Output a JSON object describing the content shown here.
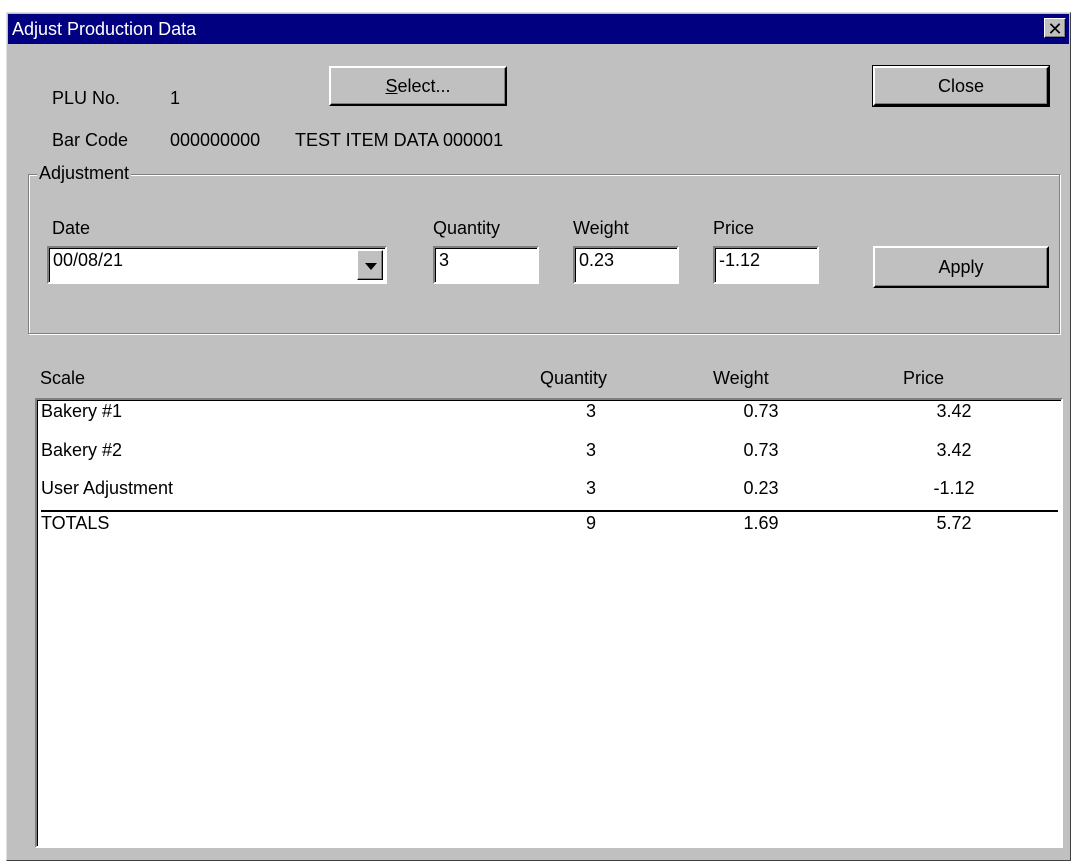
{
  "window": {
    "title": "Adjust Production Data",
    "close_glyph": "✕"
  },
  "header": {
    "plu_label": "PLU No.",
    "plu_value": "1",
    "barcode_label": "Bar Code",
    "barcode_value": "000000000",
    "item_name": "TEST ITEM DATA 000001",
    "select_button": {
      "accel": "S",
      "rest": "elect..."
    },
    "close_button": "Close"
  },
  "adjustment": {
    "group_label": "Adjustment",
    "date_label": "Date",
    "date_value": "00/08/21",
    "quantity_label": "Quantity",
    "quantity_value": "3",
    "weight_label": "Weight",
    "weight_value": "0.23",
    "price_label": "Price",
    "price_value": "-1.12",
    "apply_button": "Apply"
  },
  "table": {
    "columns": [
      "Scale",
      "Quantity",
      "Weight",
      "Price"
    ],
    "rows": [
      {
        "scale": "Bakery #1",
        "quantity": "3",
        "weight": "0.73",
        "price": "3.42"
      },
      {
        "scale": "Bakery #2",
        "quantity": "3",
        "weight": "0.73",
        "price": "3.42"
      },
      {
        "scale": "User Adjustment",
        "quantity": "3",
        "weight": "0.23",
        "price": "-1.12"
      }
    ],
    "totals": {
      "scale": "TOTALS",
      "quantity": "9",
      "weight": "1.69",
      "price": "5.72"
    }
  },
  "colors": {
    "titlebar": "#000080",
    "face": "#c0c0c0"
  }
}
